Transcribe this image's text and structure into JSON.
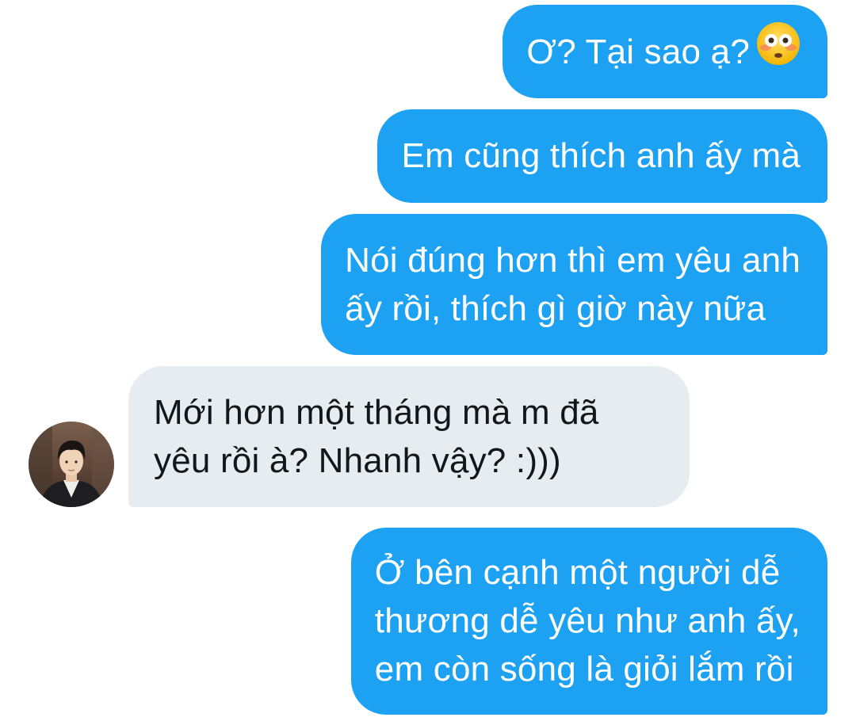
{
  "conversation": {
    "messages": [
      {
        "direction": "outgoing",
        "text": "Ơ? Tại sao ạ?",
        "emoji": "flushed-face-emoji"
      },
      {
        "direction": "outgoing",
        "text": "Em cũng thích anh ấy mà"
      },
      {
        "direction": "outgoing",
        "lines": [
          "Nói đúng hơn thì em yêu anh",
          "ấy rồi, thích gì giờ này nữa"
        ]
      },
      {
        "direction": "incoming",
        "lines": [
          "Mới hơn một tháng mà m đã",
          "yêu rồi à? Nhanh vậy? :)))"
        ],
        "avatar": "contact-avatar"
      },
      {
        "direction": "outgoing",
        "lines": [
          "Ở bên cạnh một người dễ",
          "thương dễ yêu như anh ấy,",
          "em còn sống là giỏi lắm rồi"
        ]
      }
    ]
  },
  "colors": {
    "outgoing_bubble": "#1da1f2",
    "incoming_bubble": "#e6ecf0",
    "outgoing_text": "#ffffff",
    "incoming_text": "#14171a",
    "background": "#ffffff"
  }
}
